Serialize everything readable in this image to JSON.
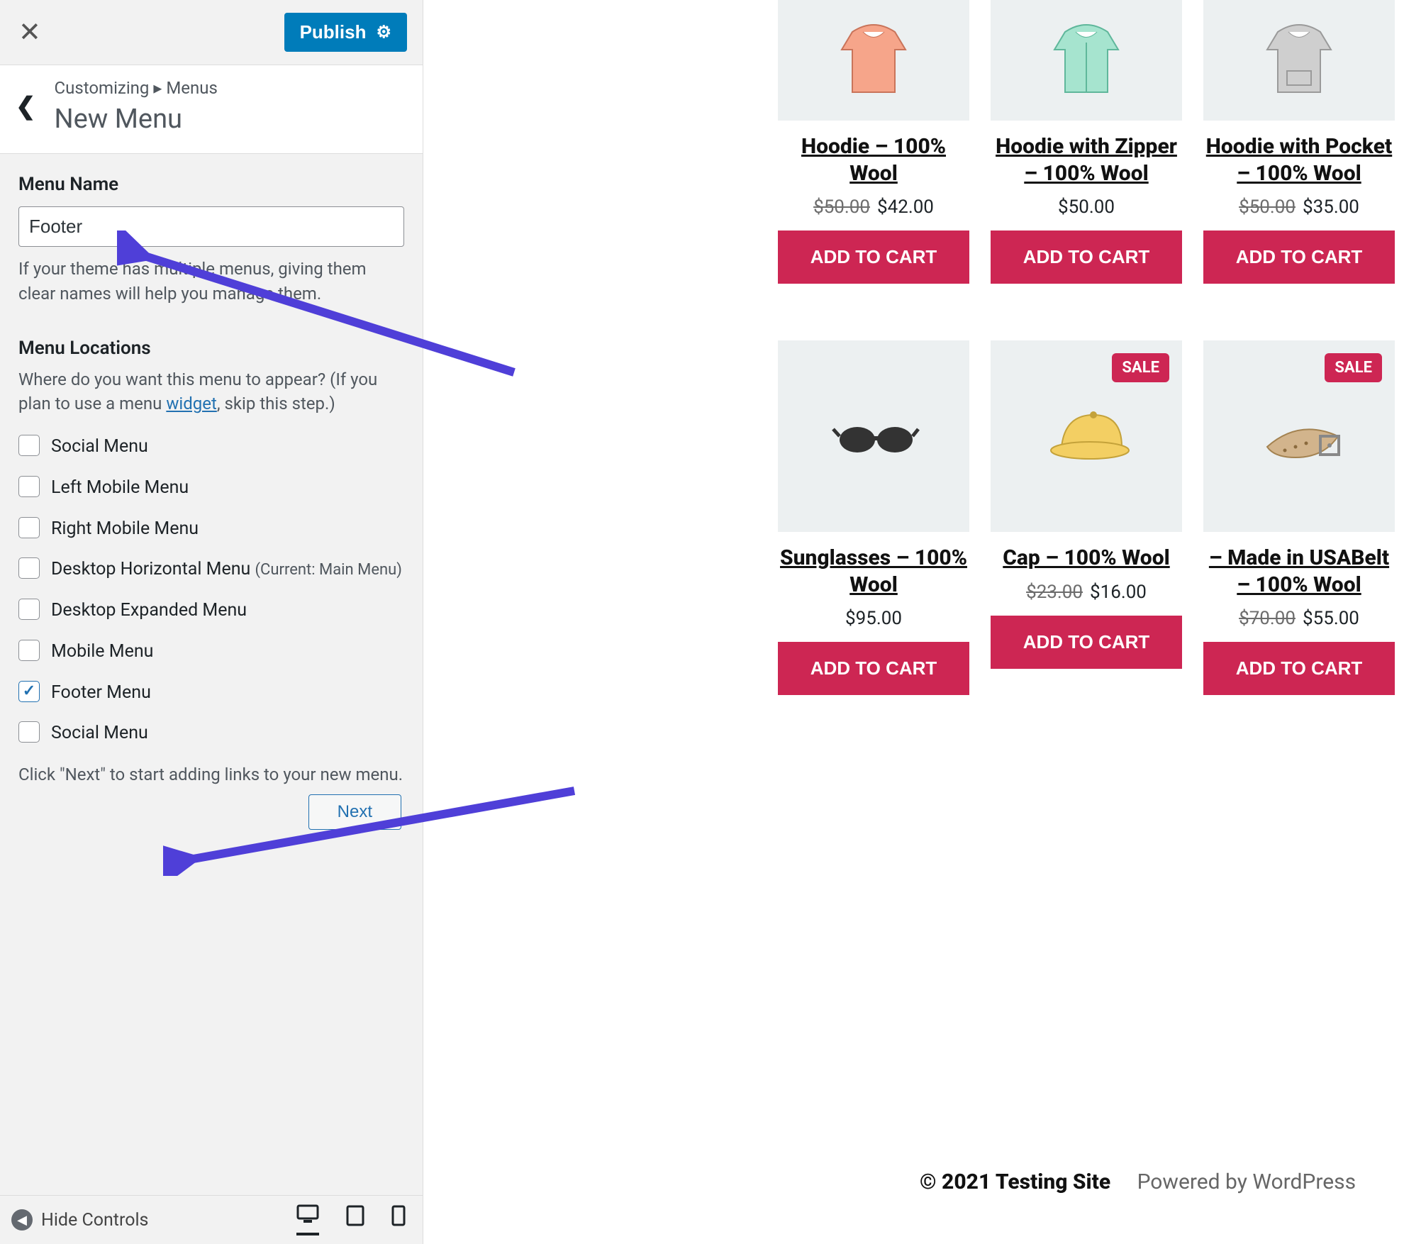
{
  "sidebar": {
    "publish_label": "Publish",
    "breadcrumb": "Customizing ▸ Menus",
    "page_title": "New Menu",
    "menu_name_label": "Menu Name",
    "menu_name_value": "Footer",
    "menu_name_help": "If your theme has multiple menus, giving them clear names will help you manage them.",
    "locations_title": "Menu Locations",
    "locations_desc_before": "Where do you want this menu to appear? (If you plan to use a menu ",
    "locations_widget_link": "widget",
    "locations_desc_after": ", skip this step.)",
    "locations": [
      {
        "label": "Social Menu",
        "checked": false,
        "sub": ""
      },
      {
        "label": "Left Mobile Menu",
        "checked": false,
        "sub": ""
      },
      {
        "label": "Right Mobile Menu",
        "checked": false,
        "sub": ""
      },
      {
        "label": "Desktop Horizontal Menu",
        "checked": false,
        "sub": "(Current: Main Menu)"
      },
      {
        "label": "Desktop Expanded Menu",
        "checked": false,
        "sub": ""
      },
      {
        "label": "Mobile Menu",
        "checked": false,
        "sub": ""
      },
      {
        "label": "Footer Menu",
        "checked": true,
        "sub": ""
      },
      {
        "label": "Social Menu",
        "checked": false,
        "sub": ""
      }
    ],
    "next_help": "Click \"Next\" to start adding links to your new menu.",
    "next_label": "Next",
    "hide_controls_label": "Hide Controls"
  },
  "products": [
    {
      "title": "Hoodie – 100% Wool",
      "old_price": "$50.00",
      "price": "$42.00",
      "sale": false,
      "button": "ADD TO CART",
      "icon": "hoodie-orange"
    },
    {
      "title": "Hoodie with Zipper – 100% Wool",
      "old_price": "",
      "price": "$50.00",
      "sale": false,
      "button": "ADD TO CART",
      "icon": "hoodie-mint"
    },
    {
      "title": "Hoodie with Pocket – 100% Wool",
      "old_price": "$50.00",
      "price": "$35.00",
      "sale": false,
      "button": "ADD TO CART",
      "icon": "hoodie-grey"
    },
    {
      "title": "Sunglasses – 100% Wool",
      "old_price": "",
      "price": "$95.00",
      "sale": false,
      "button": "ADD TO CART",
      "icon": "sunglasses"
    },
    {
      "title": "Cap – 100% Wool",
      "old_price": "$23.00",
      "price": "$16.00",
      "sale": true,
      "button": "ADD TO CART",
      "icon": "cap"
    },
    {
      "title": "– Made in USABelt – 100% Wool",
      "old_price": "$70.00",
      "price": "$55.00",
      "sale": true,
      "button": "ADD TO CART",
      "icon": "belt"
    }
  ],
  "sale_label": "SALE",
  "footer": {
    "copyright": "© 2021 Testing Site",
    "powered": "Powered by WordPress"
  }
}
